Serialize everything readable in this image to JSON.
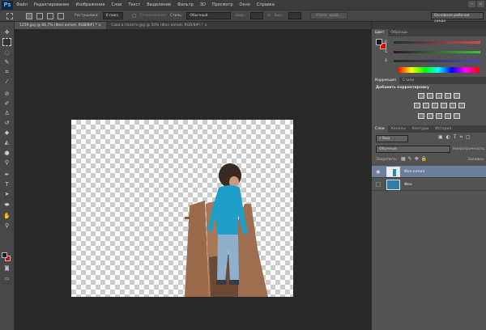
{
  "app": {
    "logo": "Ps"
  },
  "menu": [
    "Файл",
    "Редактирование",
    "Изображение",
    "Слои",
    "Текст",
    "Выделение",
    "Фильтр",
    "3D",
    "Просмотр",
    "Окно",
    "Справка"
  ],
  "window_buttons": [
    "–",
    "▫"
  ],
  "options": {
    "feather_label": "Растушевка:",
    "feather_value": "0 пикс.",
    "antialias_label": "Сглаживание",
    "style_label": "Стиль:",
    "style_value": "Обычный",
    "width_label": "Шир.:",
    "height_label": "Выс.:",
    "refine_edge": "Уточн. край...",
    "workspace": "Основная рабочая среда"
  },
  "tabs": [
    {
      "label": "1259.jpg @ 66,7% (Фон копия, RGB/8#) *",
      "close": "×"
    },
    {
      "label": "Сова в полете.jpg @ 50% (Фон копия, RGB/8#) *",
      "close": "×"
    }
  ],
  "tools": [
    "move",
    "marquee",
    "lasso",
    "quick-select",
    "crop",
    "eyedropper",
    "healing",
    "brush",
    "stamp",
    "history-brush",
    "eraser",
    "paint-bucket",
    "blur",
    "dodge",
    "pen",
    "type",
    "path-select",
    "ellipse",
    "hand",
    "zoom"
  ],
  "colors": {
    "foreground": "#1a1a1a",
    "background": "#e00000",
    "red": "#d84a4a",
    "green": "#3cc43c",
    "blue": "#4848c8",
    "layer_selected": "#6d7f9a"
  },
  "color_panel": {
    "tabs": [
      "Цвет",
      "Образцы"
    ],
    "channels": [
      "R",
      "G",
      "B"
    ]
  },
  "adjustments": {
    "tabs": [
      "Коррекция",
      "Стили"
    ],
    "title": "Добавить корректировку"
  },
  "layers_panel": {
    "tabs": [
      "Слои",
      "Каналы",
      "Контуры",
      "История"
    ],
    "filter": "Вид",
    "blend_mode": "Обычные",
    "opacity_label": "Непрозрачность:",
    "lock_label": "Закрепить:",
    "fill_label": "Заливка:",
    "layers": [
      {
        "name": "Фон копия",
        "visible": true,
        "selected": true
      },
      {
        "name": "Фон",
        "visible": false,
        "selected": false
      }
    ]
  }
}
